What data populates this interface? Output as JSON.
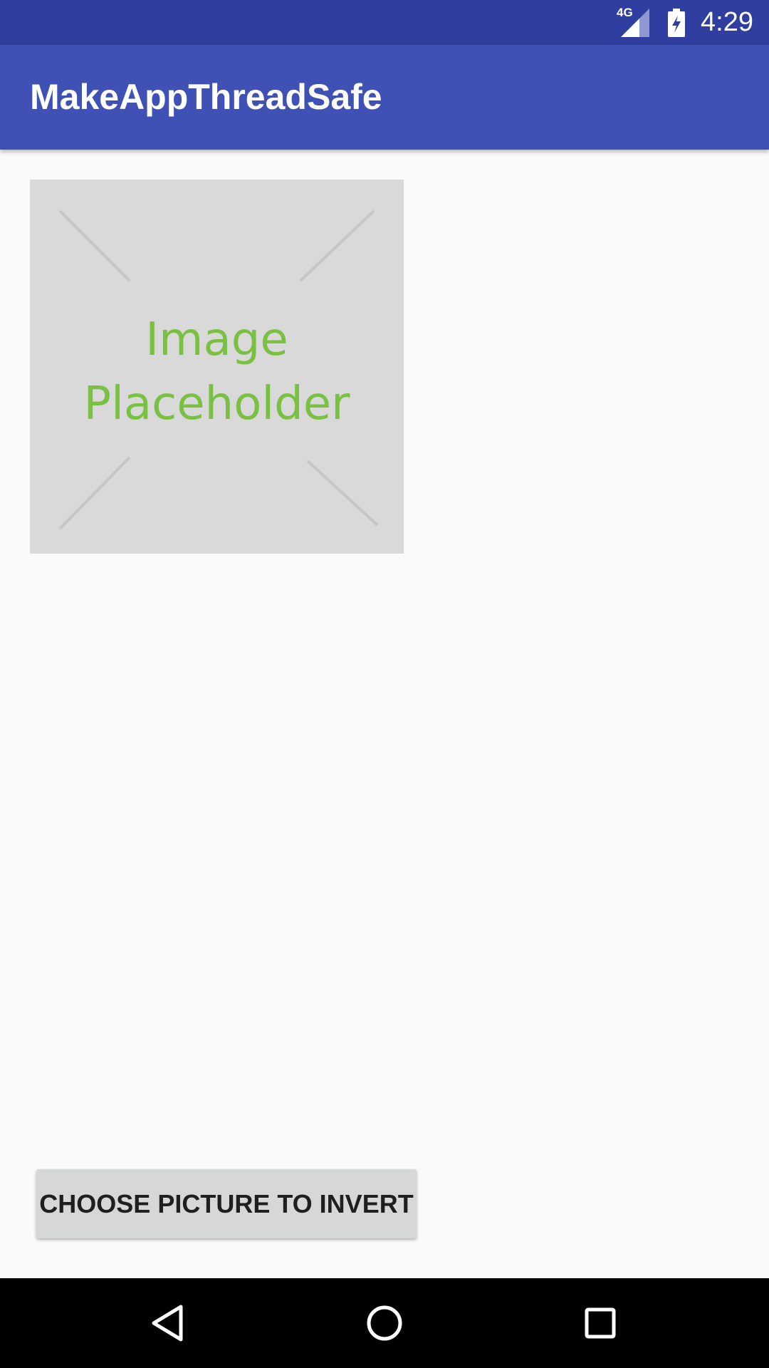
{
  "status_bar": {
    "network": "4G",
    "time": "4:29"
  },
  "app_bar": {
    "title": "MakeAppThreadSafe"
  },
  "image_view": {
    "placeholder_line1": "Image",
    "placeholder_line2": "Placeholder"
  },
  "actions": {
    "choose_button_label": "CHOOSE PICTURE TO INVERT"
  },
  "icons": {
    "signal": "cellular-signal-icon",
    "battery": "battery-charging-icon",
    "back": "back-triangle-icon",
    "home": "home-circle-icon",
    "recents": "recents-square-icon"
  },
  "colors": {
    "status_bar": "#303f9f",
    "app_bar": "#3f51b5",
    "placeholder_bg": "#d9d9d9",
    "placeholder_text": "#7ac143",
    "button_bg": "#d6d7d7",
    "nav_bar": "#000000"
  }
}
